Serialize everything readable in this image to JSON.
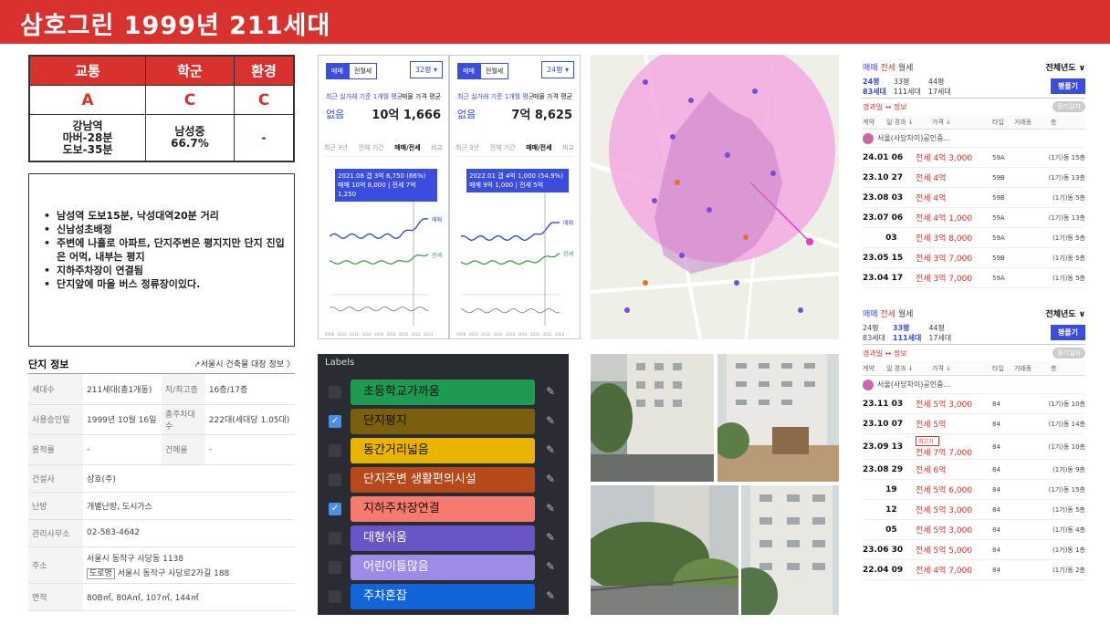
{
  "banner": {
    "title": "삼호그린  1999년 211세대"
  },
  "score": {
    "headers": [
      "교통",
      "학군",
      "환경"
    ],
    "grades": [
      "A",
      "C",
      "C"
    ],
    "details": [
      "강남역\n마버-28분\n도보-35분",
      "남성중\n66.7%",
      "-"
    ]
  },
  "notes": [
    "남성역 도보15분, 낙성대역20분 거리",
    "신남성초배정",
    "주변에 나홀로 아파트, 단지주변은 평지지만 단지 진입은 어먹, 내부는 평지",
    "지하주차장이 연결됨",
    "단지앞에 마을 버스 정류장이있다."
  ],
  "info": {
    "title": "단지 정보",
    "link": "서울시 건축물 대장 정보",
    "rows": [
      {
        "k1": "세대수",
        "v1": "211세대(총1개동)",
        "k2": "저/최고층",
        "v2": "16층/17층"
      },
      {
        "k1": "사용승인일",
        "v1": "1999년 10월 16일",
        "k2": "총주차대수",
        "v2": "222대(세대당 1.05대)"
      },
      {
        "k1": "용적률",
        "v1": "-",
        "k2": "건폐율",
        "v2": "-"
      },
      {
        "k1": "건설사",
        "v1": "삼호(주)",
        "k2": "",
        "v2": ""
      },
      {
        "k1": "난방",
        "v1": "개별난방, 도시가스",
        "k2": "",
        "v2": ""
      },
      {
        "k1": "관리사무소",
        "v1": "02-583-4642",
        "k2": "",
        "v2": ""
      },
      {
        "k1": "주소",
        "v1": "서울시 동작구 사당동 1138",
        "k2": "",
        "v2": ""
      },
      {
        "k1": "면적",
        "v1": "80B㎡, 80A㎡, 107㎡, 144㎡",
        "k2": "",
        "v2": ""
      }
    ],
    "address_road_tag": "도로명",
    "address_road": "서울시 동작구 사당로2가길 188"
  },
  "charts": [
    {
      "tab_trade": "매매",
      "tab_rent": "전월세",
      "size": "32평 ▾",
      "label_recent": "최근 실거래 기준 1개월 평균",
      "label_avg": "매물 가격 평균",
      "value_recent": "없음",
      "value_avg": "10억 1,666",
      "periods": [
        "최근 3년",
        "전체 기간",
        "매매/전세",
        "비교"
      ],
      "tip": "2021.08 갭 3억 6,750 (66%)\n매매 10억 8,000 | 전세 7억 1,250"
    },
    {
      "tab_trade": "매매",
      "tab_rent": "전월세",
      "size": "24평 ▾",
      "label_recent": "최근 실거래 기준 1개월 평균",
      "label_avg": "매물 가격 평균",
      "value_recent": "없음",
      "value_avg": "7억 8,625",
      "periods": [
        "최근 3년",
        "전체 기간",
        "매매/전세",
        "비교"
      ],
      "tip": "2022.01 갭 4억 1,000 (54.9%)\n매매 9억 1,000 | 전세 5억"
    }
  ],
  "chart_axis": {
    "years": [
      "2008",
      "2010",
      "2012",
      "2014",
      "2016",
      "2018",
      "2020",
      "2022",
      "2024"
    ],
    "series_trade": "매매",
    "series_rent": "전세"
  },
  "labels": {
    "title": "Labels",
    "items": [
      {
        "text": "초등학교가까움",
        "color": "#1e9a53",
        "checked": false
      },
      {
        "text": "단지평지",
        "color": "#7a5f0c",
        "checked": true
      },
      {
        "text": "동간거리넓음",
        "color": "#e8b400",
        "checked": false
      },
      {
        "text": "단지주변 생활편의시설",
        "color": "#b5491c",
        "checked": false
      },
      {
        "text": "지하주차장연결",
        "color": "#f47b6d",
        "checked": true
      },
      {
        "text": "대형쉬움",
        "color": "#6a55c6",
        "checked": false
      },
      {
        "text": "어린이들많음",
        "color": "#9d8be6",
        "checked": false
      },
      {
        "text": "주차혼잡",
        "color": "#1165d8",
        "checked": false
      }
    ]
  },
  "listings": [
    {
      "tabs": [
        "매매",
        "전세",
        "월세"
      ],
      "period": "전체년도 ∨",
      "sizes": [
        {
          "a": "24평",
          "b": "83세대",
          "on": true
        },
        {
          "a": "33평",
          "b": "111세대",
          "on": false
        },
        {
          "a": "44평",
          "b": "17세대",
          "on": false
        }
      ],
      "btn": "평플기",
      "sort": "경과일 ↔ 정보",
      "tag": "등기일자",
      "cols": [
        "계약",
        "일 경과 ↓",
        "가격 ↓",
        "타입",
        "거래동",
        "층"
      ],
      "agent": "서울(사당차이)공인중...",
      "rows": [
        {
          "d": "24.01  06",
          "p": "전세 4억 3,000",
          "t": "59A",
          "f": "(1기)동 15층"
        },
        {
          "d": "23.10  27",
          "p": "전세 4억",
          "t": "59B",
          "f": "(1기)동 13층"
        },
        {
          "d": "23.08  03",
          "p": "전세 4억",
          "t": "59B",
          "f": "(1기)동 5층"
        },
        {
          "d": "23.07  06",
          "p": "전세 4억 1,000",
          "t": "59A",
          "f": "(1기)동 13층"
        },
        {
          "d": "        03",
          "p": "전세 3억 8,000",
          "t": "59A",
          "f": "(1기)동 5층"
        },
        {
          "d": "23.05  15",
          "p": "전세 3억 7,000",
          "t": "59B",
          "f": "(1기)동 5층"
        },
        {
          "d": "23.04  17",
          "p": "전세 3억 7,000",
          "t": "59A",
          "f": "(1기)동 5층"
        }
      ]
    },
    {
      "tabs": [
        "매매",
        "전세",
        "월세"
      ],
      "period": "전체년도 ∨",
      "sizes": [
        {
          "a": "24평",
          "b": "83세대",
          "on": false
        },
        {
          "a": "33평",
          "b": "111세대",
          "on": true
        },
        {
          "a": "44평",
          "b": "17세대",
          "on": false
        }
      ],
      "btn": "평플기",
      "sort": "경과일 ↔ 정보",
      "tag": "등기일자",
      "cols": [
        "계약",
        "일 경과 ↓",
        "가격 ↓",
        "타입",
        "거래동",
        "층"
      ],
      "agent": "서울(사당차이)공인중...",
      "max_tag": "최고가",
      "rows": [
        {
          "d": "23.11  03",
          "p": "전세 5억 3,000",
          "t": "84",
          "f": "(1기)동 10층"
        },
        {
          "d": "23.10  07",
          "p": "전세 5억",
          "t": "84",
          "f": "(1기)동 14층"
        },
        {
          "d": "23.09  13",
          "p": "전세 7억 7,000",
          "t": "84",
          "f": "(1기)동 10층"
        },
        {
          "d": "23.08  29",
          "p": "전세 6억",
          "t": "84",
          "f": "(1기)동 9층"
        },
        {
          "d": "        19",
          "p": "전세 5억 6,000",
          "t": "84",
          "f": "(1기)동 15층"
        },
        {
          "d": "        12",
          "p": "전세 5억 3,000",
          "t": "84",
          "f": "(1기)동 5층"
        },
        {
          "d": "        05",
          "p": "전세 5억 3,000",
          "t": "84",
          "f": "(1기)동 4층"
        },
        {
          "d": "23.06  30",
          "p": "전세 5억 5,000",
          "t": "84",
          "f": "(1기)동 1층"
        },
        {
          "d": "22.04  09",
          "p": "전세 4억 7,000",
          "t": "84",
          "f": "(1기)동 2층"
        }
      ]
    }
  ]
}
